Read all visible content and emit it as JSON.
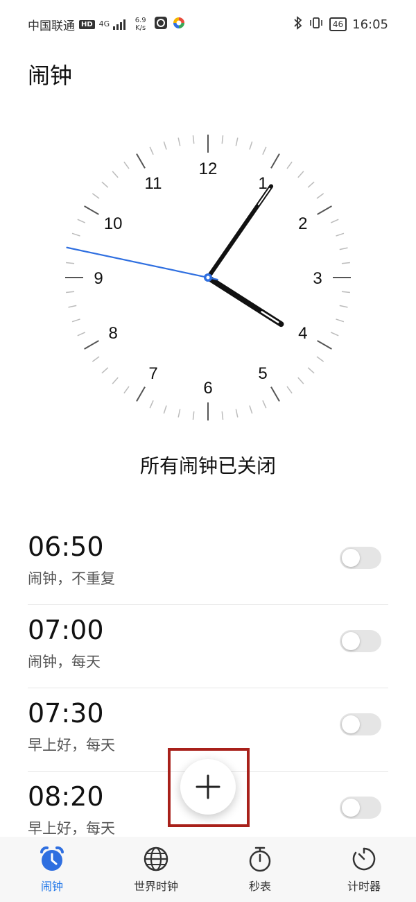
{
  "status_bar": {
    "carrier": "中国联通",
    "hd": "HD",
    "network": "4G",
    "speed_value": "6.9",
    "speed_unit": "K/s",
    "battery": "46",
    "time": "16:05"
  },
  "page_title": "闹钟",
  "clock": {
    "numbers": [
      "12",
      "1",
      "2",
      "3",
      "4",
      "5",
      "6",
      "7",
      "8",
      "9",
      "10",
      "11"
    ],
    "hour": 4,
    "minute": 5,
    "second": 47,
    "second_hand_color": "#2f6fe0"
  },
  "alarm_status": "所有闹钟已关闭",
  "alarms": [
    {
      "time": "06:50",
      "desc": "闹钟，不重复",
      "enabled": false
    },
    {
      "time": "07:00",
      "desc": "闹钟，每天",
      "enabled": false
    },
    {
      "time": "07:30",
      "desc": "早上好，每天",
      "enabled": false
    },
    {
      "time": "08:20",
      "desc": "早上好，每天",
      "enabled": false
    }
  ],
  "fab": {
    "icon": "plus-icon",
    "label": "+"
  },
  "bottom_nav": [
    {
      "label": "闹钟",
      "icon": "alarm-clock-icon",
      "active": true
    },
    {
      "label": "世界时钟",
      "icon": "globe-icon",
      "active": false
    },
    {
      "label": "秒表",
      "icon": "stopwatch-icon",
      "active": false
    },
    {
      "label": "计时器",
      "icon": "timer-icon",
      "active": false
    }
  ],
  "colors": {
    "accent": "#1a73e8",
    "highlight_box": "#a8201a"
  }
}
